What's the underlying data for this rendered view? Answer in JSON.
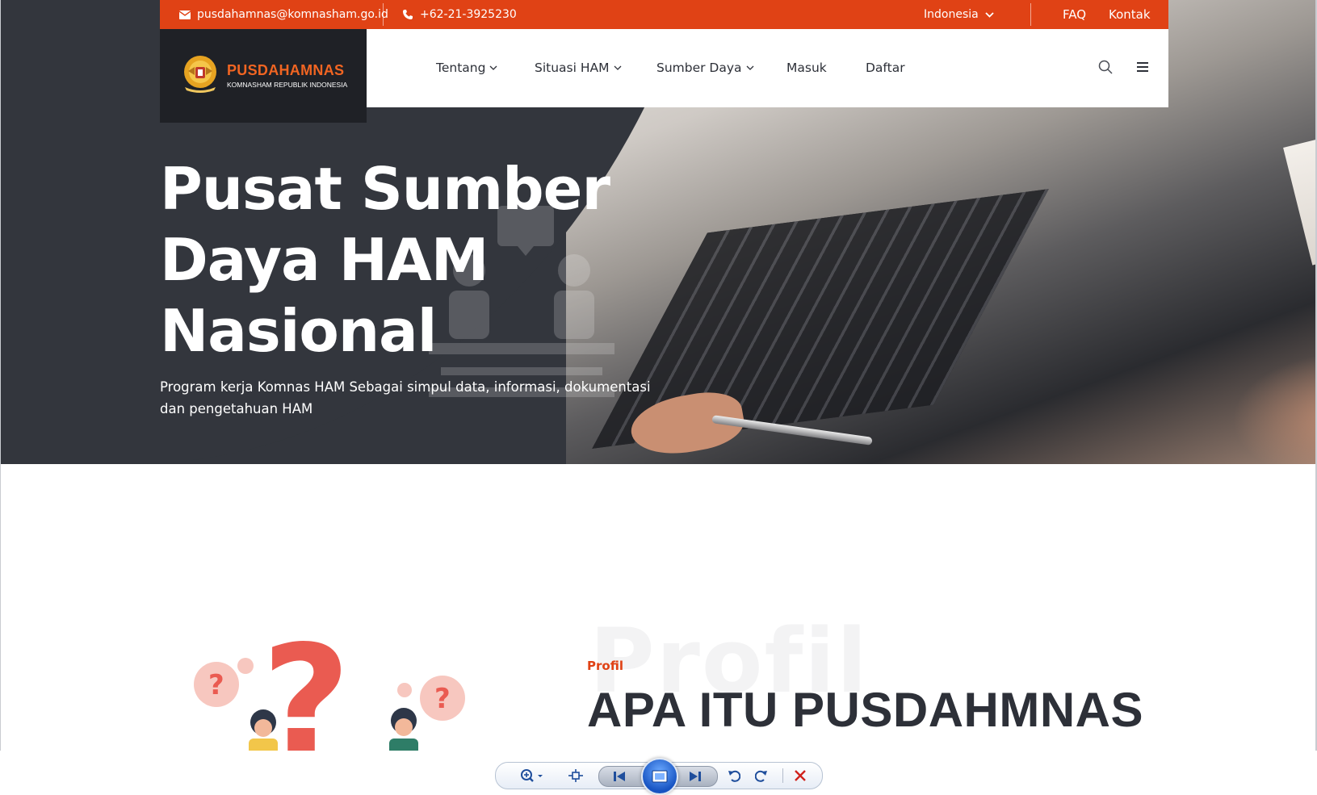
{
  "topbar": {
    "email": "pusdahamnas@komnasham.go.id",
    "phone": "+62-21-3925230",
    "language": "Indonesia",
    "faq": "FAQ",
    "contact": "Kontak"
  },
  "brand": {
    "name": "PUSDAHAMNAS",
    "subtitle": "KOMNASHAM REPUBLIK INDONESIA"
  },
  "nav": {
    "items": [
      {
        "label": "Tentang",
        "dropdown": true
      },
      {
        "label": "Situasi HAM",
        "dropdown": true
      },
      {
        "label": "Sumber Daya",
        "dropdown": true
      },
      {
        "label": "Masuk",
        "dropdown": false
      },
      {
        "label": "Daftar",
        "dropdown": false
      }
    ],
    "search_icon": "search-icon",
    "menu_icon": "hamburger-menu-icon"
  },
  "hero": {
    "title": "Pusat Sumber Daya HAM Nasional",
    "subtitle": "Program kerja Komnas HAM Sebagai simpul data, informasi, dokumentasi dan pengetahuan HAM"
  },
  "profile": {
    "ghost_text": "Profil",
    "label": "Profil",
    "title": "APA ITU PUSDAHMNAS"
  },
  "viewer_toolbar": {
    "icons": [
      "zoom-icon",
      "fit-to-window-icon",
      "previous-icon",
      "slideshow-icon",
      "next-icon",
      "rotate-counterclockwise-icon",
      "rotate-clockwise-icon",
      "delete-icon"
    ]
  },
  "colors": {
    "accent": "#e04215",
    "brand_orange": "#f16522",
    "hero_dark": "#33363d",
    "text_dark": "#2d3038"
  }
}
